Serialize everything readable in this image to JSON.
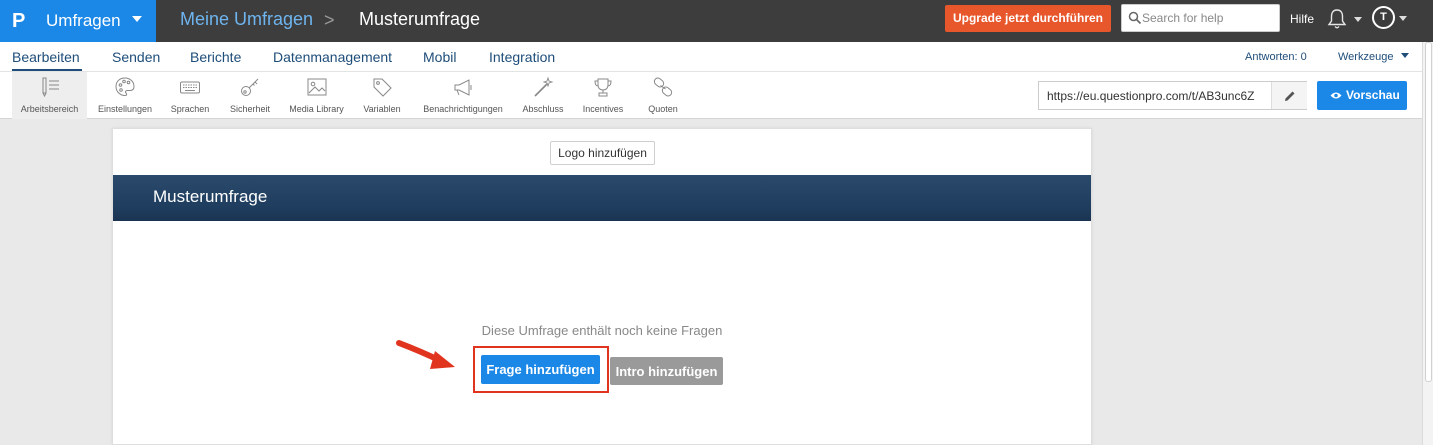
{
  "brand": {
    "name": "Umfragen",
    "logo": "P"
  },
  "breadcrumb": {
    "parent": "Meine Umfragen",
    "separator": ">",
    "current": "Musterumfrage"
  },
  "header": {
    "upgrade_label": "Upgrade jetzt durchführen",
    "search_placeholder": "Search for help",
    "help_label": "Hilfe",
    "avatar_initial": "T"
  },
  "nav": {
    "tabs": [
      "Bearbeiten",
      "Senden",
      "Berichte",
      "Datenmanagement",
      "Mobil",
      "Integration"
    ],
    "active_tab": "Bearbeiten",
    "answers_label": "Antworten: 0",
    "tools_label": "Werkzeuge"
  },
  "toolbar": {
    "items": [
      {
        "label": "Arbeitsbereich",
        "icon": "workspace-icon"
      },
      {
        "label": "Einstellungen",
        "icon": "palette-icon"
      },
      {
        "label": "Sprachen",
        "icon": "keyboard-icon"
      },
      {
        "label": "Sicherheit",
        "icon": "key-icon"
      },
      {
        "label": "Media Library",
        "icon": "image-icon"
      },
      {
        "label": "Variablen",
        "icon": "tag-icon"
      },
      {
        "label": "Benachrichtigungen",
        "icon": "megaphone-icon"
      },
      {
        "label": "Abschluss",
        "icon": "magic-wand-icon"
      },
      {
        "label": "Incentives",
        "icon": "trophy-icon"
      },
      {
        "label": "Quoten",
        "icon": "link-icon"
      }
    ],
    "survey_url": "https://eu.questionpro.com/t/AB3unc6Z",
    "preview_label": "Vorschau"
  },
  "survey": {
    "logo_button": "Logo hinzufügen",
    "title": "Musterumfrage",
    "empty_message": "Diese Umfrage enthält noch keine Fragen",
    "add_question_label": "Frage hinzufügen",
    "add_intro_label": "Intro hinzufügen"
  },
  "colors": {
    "topbar": "#3d3d3d",
    "brand": "#1b87e6",
    "upgrade": "#e8562b",
    "nav_text": "#1e4d7a",
    "survey_header": "#1f3d5e",
    "highlight": "#e0341f"
  }
}
